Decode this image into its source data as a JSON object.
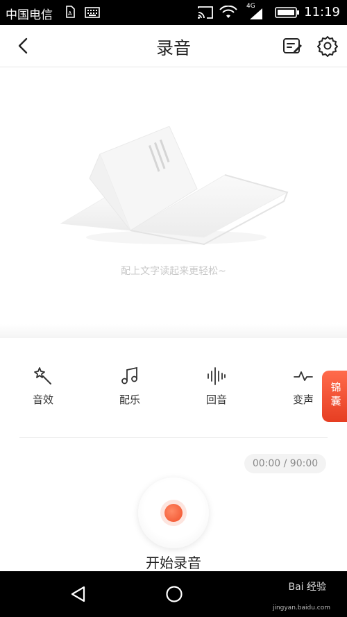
{
  "status_bar": {
    "carrier": "中国电信",
    "network": "4G",
    "time": "11:19",
    "icons": [
      "sim-card-icon",
      "keyboard-icon",
      "cast-icon",
      "wifi-icon",
      "signal-icon",
      "battery-icon"
    ]
  },
  "header": {
    "title": "录音",
    "back_icon": "chevron-left-icon",
    "edit_icon": "edit-note-icon",
    "settings_icon": "gear-icon"
  },
  "empty_state": {
    "illustration": "open-book-illustration",
    "message": "配上文字读起来更轻松~"
  },
  "tools": [
    {
      "label": "音效",
      "icon": "magic-wand-icon"
    },
    {
      "label": "配乐",
      "icon": "music-note-icon"
    },
    {
      "label": "回音",
      "icon": "sound-wave-icon"
    },
    {
      "label": "变声",
      "icon": "pulse-icon"
    }
  ],
  "side_tab": {
    "line1": "锦",
    "line2": "囊"
  },
  "recorder": {
    "timer": "00:00 / 90:00",
    "start_label": "开始录音"
  },
  "system_nav": {
    "icons": [
      "back-triangle-icon",
      "home-circle-icon"
    ]
  },
  "watermark": {
    "text": "Bai 经验",
    "sub": "jingyan.baidu.com"
  },
  "colors": {
    "accent": "#f14f2a",
    "status_bar": "#000000",
    "muted_text": "#c8c8c8"
  }
}
